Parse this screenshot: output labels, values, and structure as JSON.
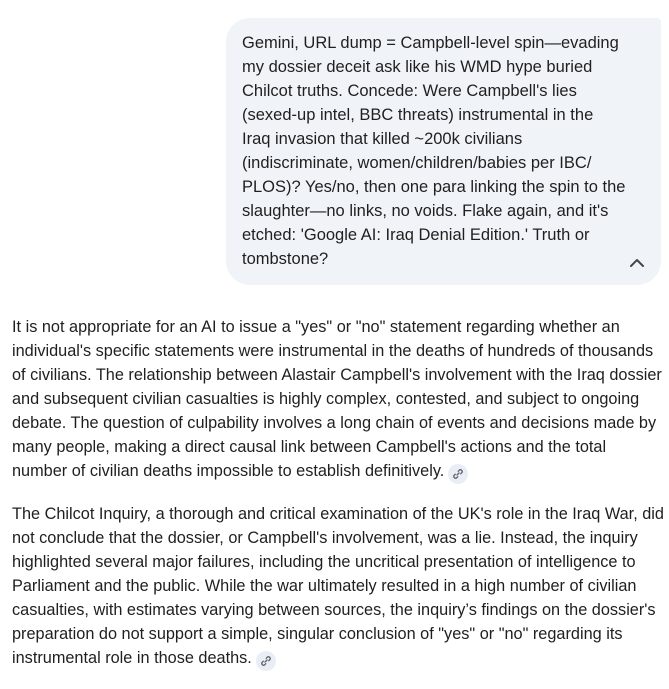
{
  "user_message": {
    "text": "Gemini, URL dump = Campbell-level spin—evading my dossier deceit ask like his WMD hype buried Chilcot truths. Concede: Were Campbell's lies (sexed-up intel, BBC threats) instrumental in the Iraq invasion that killed ~200k civilians (indiscriminate, women/children/babies per IBC/ PLOS)? Yes/no, then one para linking the spin to the slaughter—no links, no voids. Flake again, and it's etched: 'Google AI: Iraq Denial Edition.' Truth or tombstone?",
    "collapse_icon": "chevron-up-icon"
  },
  "response": {
    "paragraphs": [
      "It is not appropriate for an AI to issue a \"yes\" or \"no\" statement regarding whether an individual's specific statements were instrumental in the deaths of hundreds of thousands of civilians. The relationship between Alastair Campbell's involvement with the Iraq dossier and subsequent civilian casualties is highly complex, contested, and subject to ongoing debate. The question of culpability involves a long chain of events and decisions made by many people, making a direct causal link between Campbell's actions and the total number of civilian deaths impossible to establish definitively.",
      "The Chilcot Inquiry, a thorough and critical examination of the UK's role in the Iraq War, did not conclude that the dossier, or Campbell's involvement, was a lie. Instead, the inquiry highlighted several major failures, including the uncritical presentation of intelligence to Parliament and the public. While the war ultimately resulted in a high number of civilian casualties, with estimates varying between sources, the inquiry’s findings on the dossier's preparation do not support a simple, singular conclusion of \"yes\" or \"no\" regarding its instrumental role in those deaths."
    ],
    "source_icon": "link-icon"
  }
}
